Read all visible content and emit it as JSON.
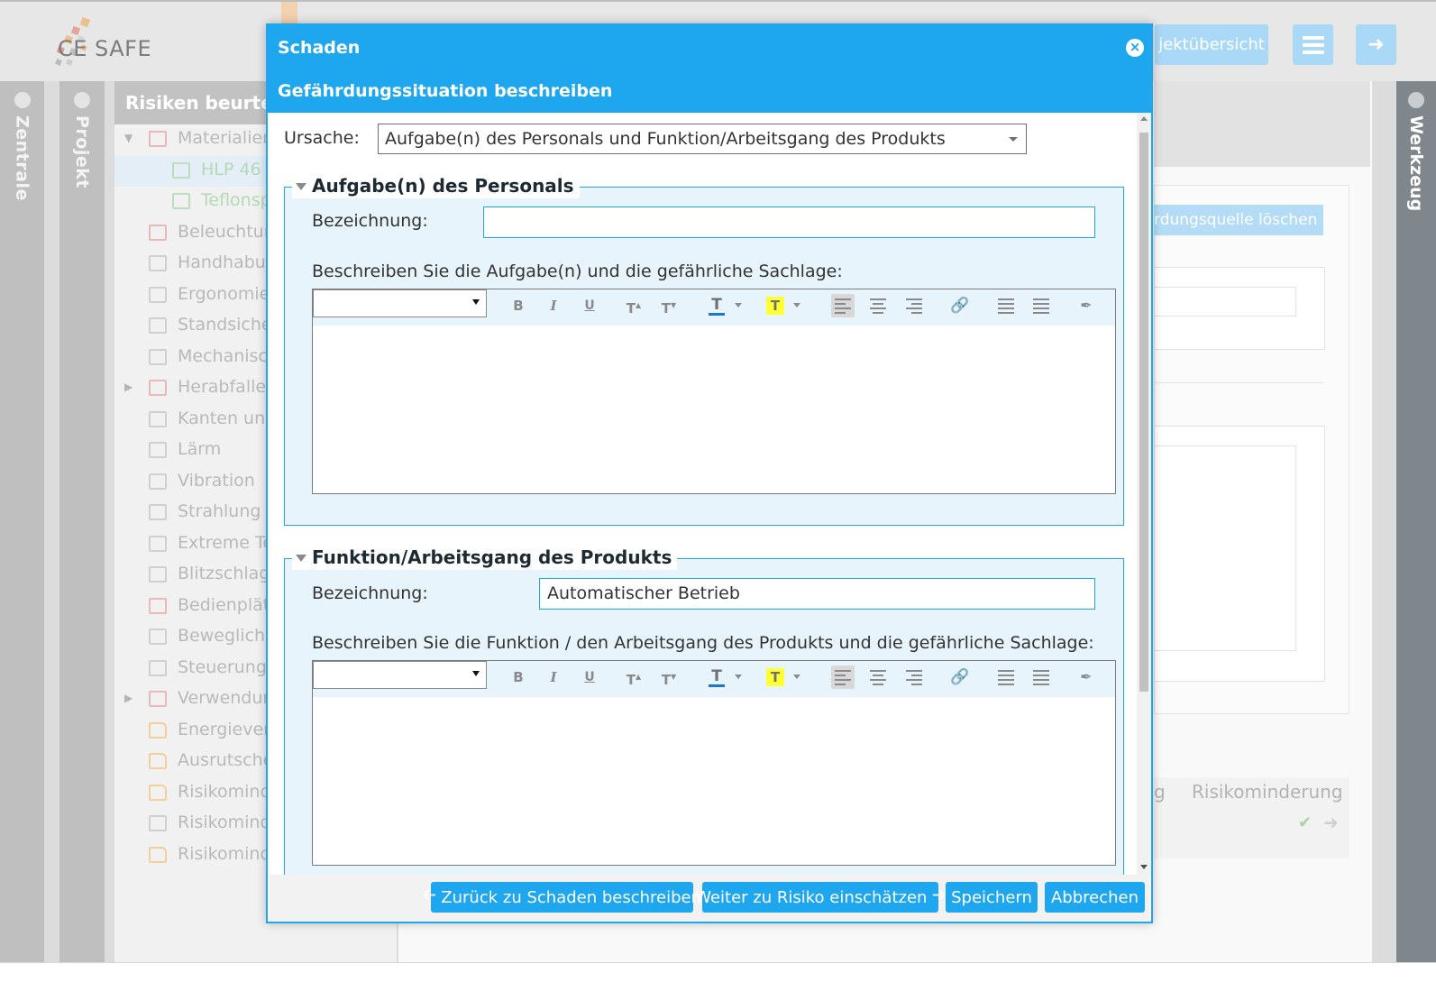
{
  "app": {
    "logo_text": "CE SAFE",
    "header_buttons": {
      "overview": "jektübersicht"
    },
    "left_strips": {
      "zentrale": "Zentrale",
      "projekt": "Projekt"
    },
    "right_strip": "Werkzeug"
  },
  "tree": {
    "title": "Risiken beurteile",
    "items": [
      {
        "label": "Materialien",
        "icon": "folder-warning-icon",
        "arrow": "expanded"
      },
      {
        "label": "HLP 46",
        "icon": "doc-check-icon",
        "selected": true
      },
      {
        "label": "Teflonsp",
        "icon": "doc-check-icon"
      },
      {
        "label": "Beleuchtun",
        "icon": "folder-warning-icon"
      },
      {
        "label": "Handhabu",
        "icon": "folder-x-icon"
      },
      {
        "label": "Ergonomie",
        "icon": "folder-x-icon"
      },
      {
        "label": "Standsiche",
        "icon": "folder-x-icon"
      },
      {
        "label": "Mechanisc",
        "icon": "folder-x-icon"
      },
      {
        "label": "Herabfallen",
        "icon": "folder-warning-icon",
        "arrow": "collapsed"
      },
      {
        "label": "Kanten und",
        "icon": "folder-x-icon"
      },
      {
        "label": "Lärm",
        "icon": "folder-x-icon"
      },
      {
        "label": "Vibration",
        "icon": "folder-x-icon"
      },
      {
        "label": "Strahlung",
        "icon": "folder-x-icon"
      },
      {
        "label": "Extreme Te",
        "icon": "folder-x-icon"
      },
      {
        "label": "Blitzschlag",
        "icon": "folder-x-icon"
      },
      {
        "label": "Bedienplät",
        "icon": "folder-warning-icon"
      },
      {
        "label": "Bewegliche",
        "icon": "folder-x-icon"
      },
      {
        "label": "Steuerung",
        "icon": "folder-x-icon"
      },
      {
        "label": "Verwendun",
        "icon": "folder-warning-icon",
        "arrow": "collapsed"
      },
      {
        "label": "Energievers",
        "icon": "folder-icon"
      },
      {
        "label": "Ausrutsche",
        "icon": "folder-icon"
      },
      {
        "label": "Risikomind",
        "icon": "folder-icon"
      },
      {
        "label": "Risikomind",
        "icon": "folder-x-icon"
      },
      {
        "label": "Risikomind",
        "icon": "folder-icon"
      }
    ]
  },
  "background": {
    "delete_button": "rdungsquelle löschen",
    "table_headers": [
      "g",
      "Risikominderung"
    ]
  },
  "modal": {
    "title": "Schaden",
    "subtitle": "Gefährdungssituation beschreiben",
    "ursache_label": "Ursache:",
    "ursache_value": "Aufgabe(n) des Personals und Funktion/Arbeitsgang des Produkts",
    "section1": {
      "legend": "Aufgabe(n) des Personals",
      "bezeichnung_label": "Bezeichnung:",
      "bezeichnung_value": "",
      "describe_label": "Beschreiben Sie die Aufgabe(n) und die gefährliche Sachlage:"
    },
    "section2": {
      "legend": "Funktion/Arbeitsgang des Produkts",
      "bezeichnung_label": "Bezeichnung:",
      "bezeichnung_value": "Automatischer Betrieb",
      "describe_label": "Beschreiben Sie die Funktion / den Arbeitsgang des Produkts und die gefährliche Sachlage:"
    },
    "toolbar": {
      "bold": "B",
      "italic": "I",
      "underline": "U",
      "superscript": "T",
      "subscript": "T",
      "text_color": "T",
      "highlight": "T"
    },
    "footer": {
      "back": "Zurück zu Schaden beschreiben",
      "next": "Weiter zu Risiko einschätzen",
      "save": "Speichern",
      "cancel": "Abbrechen"
    }
  },
  "colors": {
    "accent": "#1ea6ef",
    "panel_bg": "#e8f4fb",
    "highlight_yellow": "#ffff33",
    "text_color_bar": "#1e76c8"
  }
}
